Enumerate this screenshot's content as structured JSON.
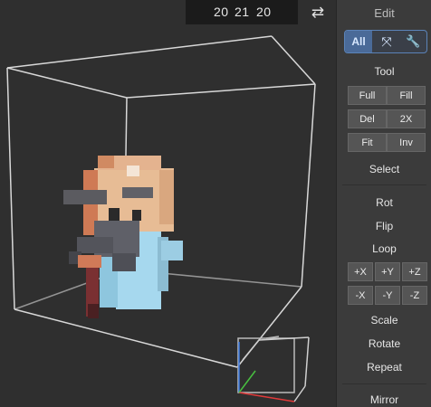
{
  "header": {
    "dims": [
      "20",
      "21",
      "20"
    ],
    "swap_icon": "swap-arrows-icon"
  },
  "panel": {
    "title": "Edit",
    "mode": {
      "all_label": "All",
      "icons": [
        "expand-arrows-icon",
        "wrench-icon"
      ]
    },
    "tool_label": "Tool",
    "tool_buttons": [
      "Full",
      "Fill",
      "Del",
      "2X",
      "Fit",
      "Inv"
    ],
    "select_label": "Select",
    "rot_label": "Rot",
    "flip_label": "Flip",
    "loop_label": "Loop",
    "axis_buttons": [
      "+X",
      "+Y",
      "+Z",
      "-X",
      "-Y",
      "-Z"
    ],
    "scale_label": "Scale",
    "rotate_label": "Rotate",
    "repeat_label": "Repeat",
    "mirror_label": "Mirror"
  },
  "colors": {
    "accent": "#5b83b8",
    "viewport_bg": "#2f2f2f",
    "panel_bg": "#3b3b3b"
  }
}
